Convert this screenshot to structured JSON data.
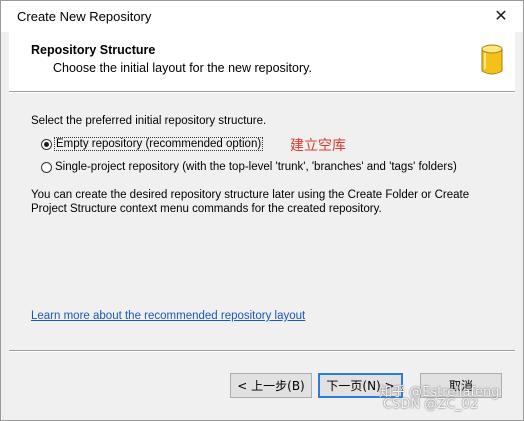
{
  "window": {
    "title": "Create New Repository",
    "close_icon": "close-icon"
  },
  "header": {
    "heading": "Repository Structure",
    "subheading": "Choose the initial layout for the new repository.",
    "icon": "database-icon",
    "icon_color": "#f2c21b"
  },
  "content": {
    "prompt": "Select the preferred initial repository structure.",
    "options": [
      {
        "label": "Empty repository (recommended option)",
        "selected": true
      },
      {
        "label": "Single-project repository (with the top-level 'trunk', 'branches' and 'tags' folders)",
        "selected": false
      }
    ],
    "annotation": "建立空库",
    "info": "You can create the desired repository structure later using the Create Folder or Create Project Structure context menu commands for the created repository.",
    "link": "Learn more about the recommended repository layout"
  },
  "buttons": {
    "back": "< 上一步(B)",
    "next": "下一页(N) >",
    "cancel": "取消"
  },
  "watermark": {
    "line1": "知乎 @Estrellafeng",
    "line2": "CSDN @ZC_02"
  },
  "colors": {
    "link": "#1c58b8",
    "annotation": "#e03a2a",
    "default_button_border": "#2f7bd8"
  }
}
